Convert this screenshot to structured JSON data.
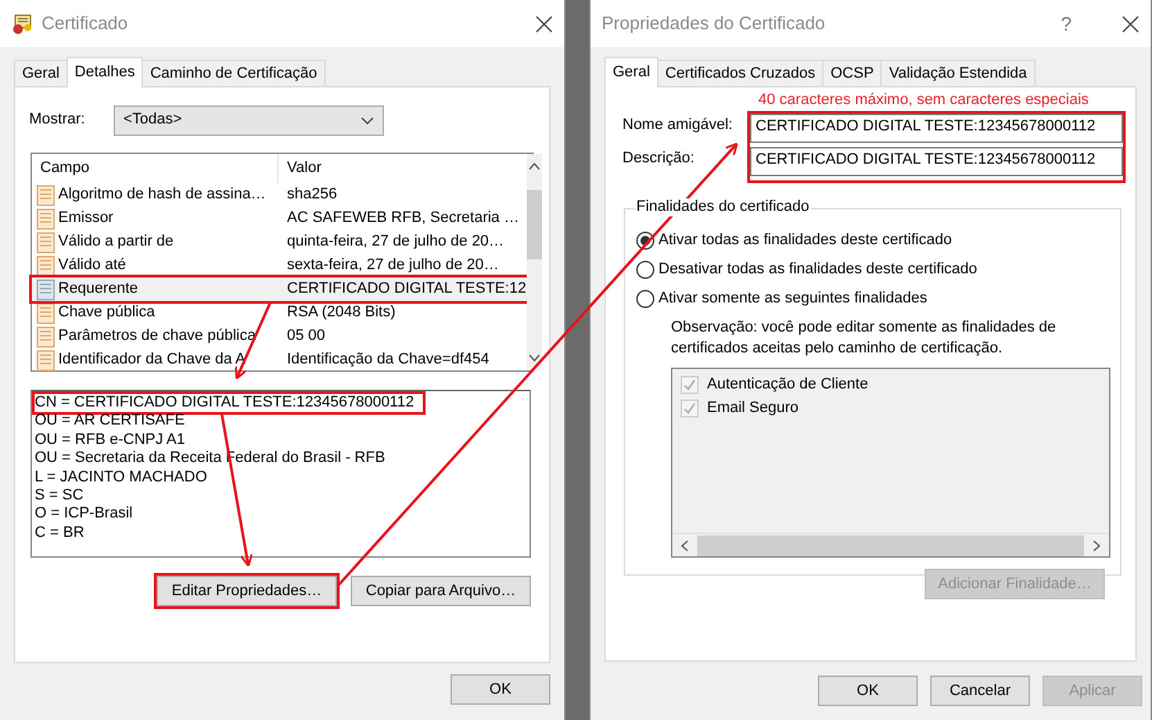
{
  "left_window": {
    "title": "Certificado",
    "tabs": [
      {
        "label": "Geral",
        "selected": false
      },
      {
        "label": "Detalhes",
        "selected": true
      },
      {
        "label": "Caminho de Certificação",
        "selected": false
      }
    ],
    "show_label": "Mostrar:",
    "show_value": "<Todas>",
    "fields_table": {
      "columns": [
        "Campo",
        "Valor"
      ],
      "rows": [
        {
          "field": "Algoritmo de hash de assina…",
          "value": "sha256",
          "selected": false,
          "highlighted": false
        },
        {
          "field": "Emissor",
          "value": "AC SAFEWEB RFB, Secretaria …",
          "selected": false,
          "highlighted": false
        },
        {
          "field": "Válido a partir de",
          "value": "quinta-feira, 27 de julho de 20…",
          "selected": false,
          "highlighted": false
        },
        {
          "field": "Válido até",
          "value": "sexta-feira, 27 de julho de 20…",
          "selected": false,
          "highlighted": false
        },
        {
          "field": "Requerente",
          "value": "CERTIFICADO DIGITAL TESTE:12",
          "selected": true,
          "highlighted": true
        },
        {
          "field": "Chave pública",
          "value": "RSA (2048 Bits)",
          "selected": false,
          "highlighted": false
        },
        {
          "field": "Parâmetros de chave pública",
          "value": "05 00",
          "selected": false,
          "highlighted": false
        },
        {
          "field": "Identificador da Chave da A",
          "value": "Identificação da Chave=df454",
          "selected": false,
          "highlighted": false
        }
      ]
    },
    "details_lines": [
      {
        "text": "CN =  CERTIFICADO DIGITAL TESTE:12345678000112",
        "highlighted": true
      },
      {
        "text": "OU = AR CERTISAFE",
        "highlighted": false
      },
      {
        "text": "OU = RFB e-CNPJ A1",
        "highlighted": false
      },
      {
        "text": "OU = Secretaria da Receita Federal do Brasil - RFB",
        "highlighted": false
      },
      {
        "text": "L = JACINTO MACHADO",
        "highlighted": false
      },
      {
        "text": "S = SC",
        "highlighted": false
      },
      {
        "text": "O = ICP-Brasil",
        "highlighted": false
      },
      {
        "text": "C = BR",
        "highlighted": false
      }
    ],
    "buttons": [
      {
        "label": "Editar Propriedades…",
        "highlighted": true
      },
      {
        "label": "Copiar para Arquivo…",
        "highlighted": false
      }
    ],
    "ok_button": "OK"
  },
  "right_window": {
    "title": "Propriedades do Certificado",
    "help_glyph": "?",
    "tabs": [
      {
        "label": "Geral",
        "selected": true
      },
      {
        "label": "Certificados Cruzados",
        "selected": false
      },
      {
        "label": "OCSP",
        "selected": false
      },
      {
        "label": "Validação Estendida",
        "selected": false
      }
    ],
    "annotation_note": "40 caracteres máximo, sem caracteres especiais",
    "fields_highlighted": true,
    "fields": [
      {
        "label": "Nome amigável:",
        "value": "CERTIFICADO DIGITAL TESTE:12345678000112"
      },
      {
        "label": "Descrição:",
        "value": "CERTIFICADO DIGITAL TESTE:12345678000112"
      }
    ],
    "purposes_group": {
      "legend": "Finalidades do certificado",
      "options": [
        {
          "label": "Ativar todas as finalidades deste certificado",
          "selected": true
        },
        {
          "label": "Desativar todas as finalidades deste certificado",
          "selected": false
        },
        {
          "label": "Ativar somente as seguintes finalidades",
          "selected": false
        }
      ],
      "note": "Observação: você pode editar somente as finalidades de certificados aceitas pelo caminho de certificação.",
      "purposes": [
        {
          "label": "Autenticação de Cliente",
          "checked": true,
          "disabled": true
        },
        {
          "label": "Email Seguro",
          "checked": true,
          "disabled": true
        }
      ],
      "add_button": {
        "label": "Adicionar Finalidade…",
        "disabled": true
      }
    },
    "footer_buttons": [
      {
        "label": "OK",
        "disabled": false
      },
      {
        "label": "Cancelar",
        "disabled": false
      },
      {
        "label": "Aplicar",
        "disabled": true
      }
    ]
  }
}
